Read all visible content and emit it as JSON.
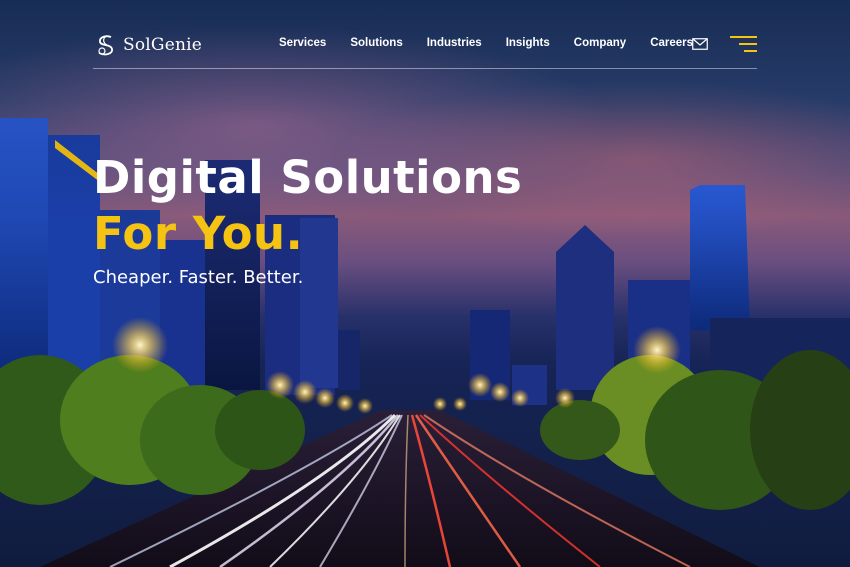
{
  "brand": {
    "name": "SolGenie",
    "logo_icon": "solgenie-s-logo-icon"
  },
  "nav": {
    "items": [
      {
        "label": "Services"
      },
      {
        "label": "Solutions"
      },
      {
        "label": "Industries"
      },
      {
        "label": "Insights"
      },
      {
        "label": "Company"
      },
      {
        "label": "Careers"
      }
    ],
    "mail_icon": "envelope-icon",
    "menu_icon": "hamburger-menu-icon"
  },
  "hero": {
    "headline_line1": "Digital Solutions",
    "headline_line2": "For You.",
    "tagline": "Cheaper. Faster. Better.",
    "background": "night-city-highway-light-trails-image"
  },
  "colors": {
    "accent": "#f5c311",
    "text": "#ffffff",
    "sky_top": "#1d3560",
    "sky_glow": "#8a5a7a"
  }
}
